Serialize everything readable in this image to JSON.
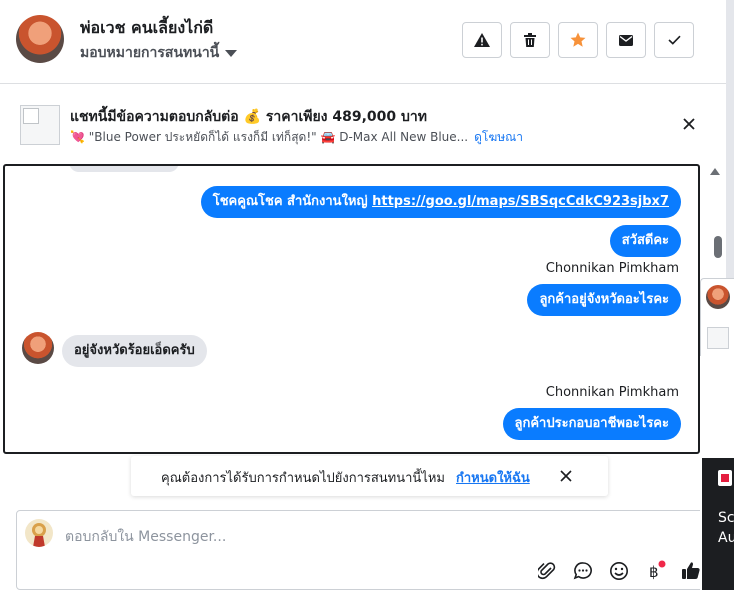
{
  "header": {
    "contact_name": "พ่อเวช คนเลี้ยงไก่ดี",
    "assign_label": "มอบหมายการสนทนานี้",
    "actions": [
      {
        "name": "spam-button",
        "icon": "warning-triangle-icon"
      },
      {
        "name": "delete-button",
        "icon": "trash-icon"
      },
      {
        "name": "star-button",
        "icon": "star-icon",
        "color": "#f7923a"
      },
      {
        "name": "mark-unread-button",
        "icon": "envelope-icon"
      },
      {
        "name": "mark-done-button",
        "icon": "check-icon"
      }
    ]
  },
  "ad": {
    "title": "แชทนี้มีข้อความตอบกลับต่อ 💰 ราคาเพียง 489,000 บาท",
    "subtitle": "💘 \"Blue Power ประหยัดก็ได้ แรงก็มี เท่ก็สุด!\" 🚘 D-Max All New Blue...",
    "link": "ดูโฆษณา"
  },
  "messages": [
    {
      "direction": "out",
      "text": "โชคคูณโชค สำนักงานใหญ่ ",
      "link": "https://goo.gl/maps/SBSqcCdkC923sjbx7"
    },
    {
      "direction": "out",
      "text": "สวัสดีคะ"
    },
    {
      "sender": "Chonnikan Pimkham"
    },
    {
      "direction": "out",
      "text": "ลูกค้าอยู่จังหวัดอะไรคะ"
    },
    {
      "direction": "in",
      "text": "อยู่จังหวัดร้อยเอ็ดครับ"
    },
    {
      "sender": "Chonnikan Pimkham"
    },
    {
      "direction": "out",
      "text": "ลูกค้าประกอบอาชีพอะไรคะ"
    }
  ],
  "assign_banner": {
    "text": "คุณต้องการได้รับการกำหนดไปยังการสนทนานี้ไหม",
    "link": "กำหนดให้ฉัน"
  },
  "composer": {
    "placeholder": "ตอบกลับใน Messenger...",
    "tools": [
      "paperclip-icon",
      "saved-replies-icon",
      "emoji-icon",
      "payment-icon",
      "like-icon"
    ]
  },
  "floating_panel": {
    "text_line1": "Scr",
    "text_line2": "Au"
  },
  "colors": {
    "accent": "#0a7cff",
    "link": "#1877f2",
    "incoming_bubble": "#e4e6eb"
  }
}
